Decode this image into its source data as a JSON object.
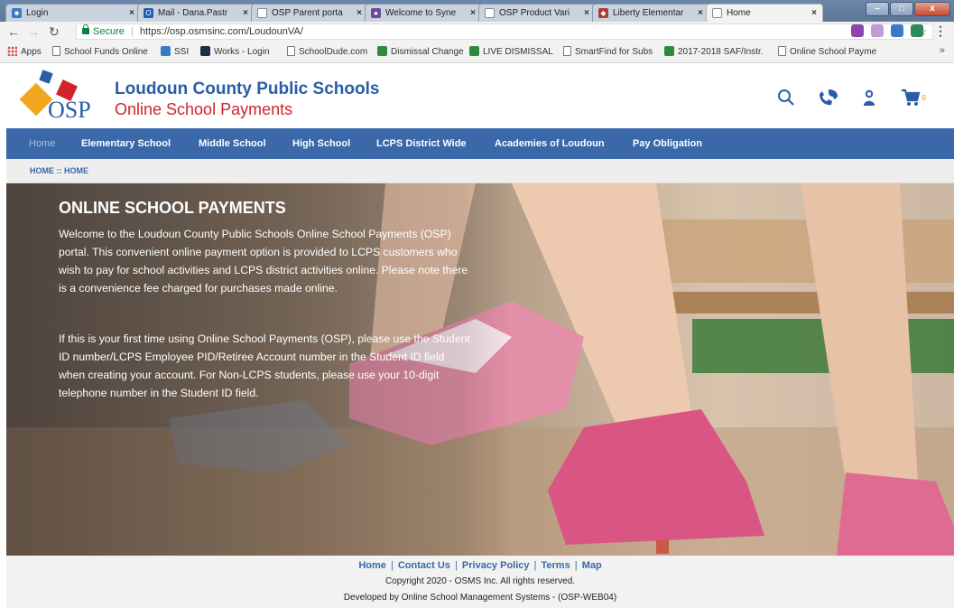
{
  "browser": {
    "tabs": [
      {
        "title": "Login",
        "icon_color": "#3b78c6",
        "icon_glyph": "■"
      },
      {
        "title": "Mail - Dana.Pastr",
        "icon_color": "#1f5fb0",
        "icon_glyph": "O"
      },
      {
        "title": "OSP Parent porta",
        "icon_color": "#888888",
        "icon_glyph": ""
      },
      {
        "title": "Welcome to Syne",
        "icon_color": "#6a4c9c",
        "icon_glyph": "●"
      },
      {
        "title": "OSP Product Vari",
        "icon_color": "#888888",
        "icon_glyph": ""
      },
      {
        "title": "Liberty Elementar",
        "icon_color": "#b03a2e",
        "icon_glyph": "◆"
      },
      {
        "title": "Home",
        "icon_color": "#888888",
        "icon_glyph": ""
      }
    ],
    "tab_close_glyph": "×",
    "window_buttons": [
      "–",
      "□",
      "x"
    ],
    "secure_label": "Secure",
    "url": "https://osp.osmsinc.com/LoudounVA/",
    "url_separator": "|",
    "bookmarks": [
      {
        "label": "Apps",
        "icon": "apps"
      },
      {
        "label": "School Funds Online",
        "icon": "page"
      },
      {
        "label": "SSI",
        "icon": "ssi"
      },
      {
        "label": "Works - Login",
        "icon": "works"
      },
      {
        "label": "SchoolDude.com",
        "icon": "page"
      },
      {
        "label": "Dismissal Change",
        "icon": "green"
      },
      {
        "label": "LIVE DISMISSAL",
        "icon": "green"
      },
      {
        "label": "SmartFind for Subs",
        "icon": "page"
      },
      {
        "label": "2017-2018 SAF/Instr.",
        "icon": "green"
      },
      {
        "label": "Online School Payme",
        "icon": "page"
      }
    ],
    "bookmarks_more": "»"
  },
  "header": {
    "logo_text": "OSP",
    "title": "Loudoun County Public Schools",
    "subtitle": "Online School Payments",
    "cart_count": "0"
  },
  "nav": {
    "items": [
      "Home",
      "Elementary School",
      "Middle School",
      "High School",
      "LCPS District Wide",
      "Academies of Loudoun",
      "Pay Obligation"
    ]
  },
  "breadcrumb": "HOME :: HOME",
  "hero": {
    "title": "ONLINE SCHOOL PAYMENTS",
    "paragraph1": "Welcome to the Loudoun County Public Schools Online School Payments (OSP) portal. This convenient online payment option is provided to LCPS customers who wish to pay for school activities and LCPS district activities online. Please note there is a convenience fee charged for purchases made online.",
    "paragraph2": "If this is your first time using Online School Payments (OSP), please use the Student ID number/LCPS Employee PID/Retiree Account number in the Student ID field when creating your account. For Non-LCPS students, please use your 10-digit telephone number in the Student ID field."
  },
  "footer": {
    "links": [
      "Home",
      "Contact Us",
      "Privacy Policy",
      "Terms",
      "Map"
    ],
    "link_separator": "|",
    "copyright": "Copyright 2020 - OSMS Inc. All rights reserved.",
    "developed_by": "Developed by Online School Management Systems - (OSP-WEB04)"
  },
  "colors": {
    "nav_bg": "#3a68a8",
    "title_blue": "#2a5da8",
    "subtitle_red": "#d2232a"
  }
}
